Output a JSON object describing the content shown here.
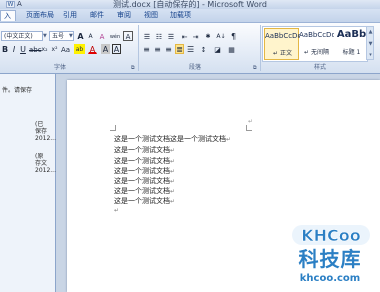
{
  "window": {
    "title": "测试.docx [自动保存的] - Microsoft Word"
  },
  "quick_access": {
    "format_glyph": "A"
  },
  "tabs": [
    {
      "label": "入"
    },
    {
      "label": "页面布局"
    },
    {
      "label": "引用"
    },
    {
      "label": "邮件"
    },
    {
      "label": "审阅"
    },
    {
      "label": "视图"
    },
    {
      "label": "加载项"
    }
  ],
  "ribbon": {
    "font": {
      "family": "(中文正文)",
      "size": "五号",
      "grow_glyph": "A",
      "shrink_glyph": "A",
      "clear_glyph": "A",
      "phonetic_glyph": "wén",
      "border_glyph": "A",
      "subscript_glyph": "x₂",
      "superscript_glyph": "x²",
      "case_glyph": "Aa",
      "highlight_glyph": "ab",
      "color_glyph": "A",
      "shade_glyph": "A",
      "char_border_glyph": "A",
      "group_label": "字体"
    },
    "paragraph": {
      "group_label": "段落",
      "sort_glyph": "A↓",
      "mark_glyph": "¶"
    },
    "styles": {
      "group_label": "样式",
      "tiles": [
        {
          "sample": "AaBbCcDd",
          "name": "↵ 正文",
          "selected": true
        },
        {
          "sample": "AaBbCcDd",
          "name": "↵ 无间隔",
          "selected": false
        },
        {
          "sample": "AaBb",
          "name": "标题 1",
          "selected": false
        }
      ]
    }
  },
  "left_pane": {
    "line1": "件。请保存",
    "items": [
      {
        "line1": "(已",
        "line2": "保存",
        "line3": "2012..."
      },
      {
        "line1": "(原",
        "line2": "存文",
        "line3": "2012..."
      }
    ]
  },
  "document": {
    "lines": [
      "这是一个测试文档这是一个测试文档",
      "这是一个测试文档",
      "这是一个测试文档",
      "这是一个测试文档",
      "这是一个测试文档",
      "这是一个测试文档",
      "这是一个测试文档"
    ],
    "paragraph_mark": "↵",
    "empty_paragraph_mark": "↵",
    "right_margin_mark": "↵"
  },
  "watermark": {
    "logo_text": "KHCoo",
    "chinese_text": "科技库",
    "url_text": "khcoo.com"
  }
}
